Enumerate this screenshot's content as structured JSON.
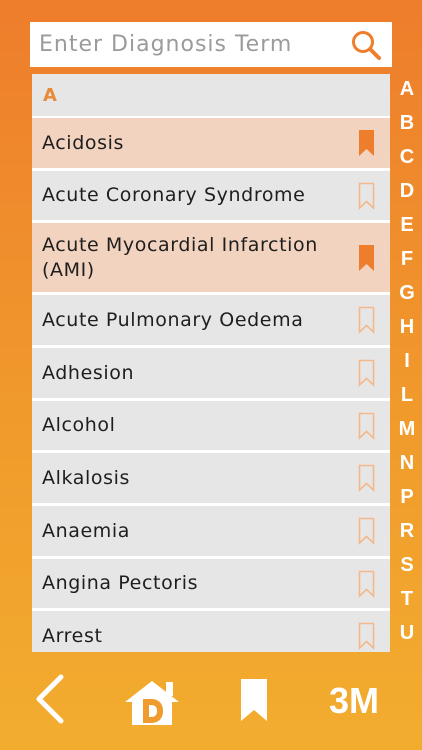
{
  "search": {
    "placeholder": "Enter Diagnosis Term"
  },
  "list": {
    "section_header": "A",
    "items": [
      {
        "label": "Acidosis",
        "bookmarked": true
      },
      {
        "label": "Acute Coronary Syndrome",
        "bookmarked": false
      },
      {
        "label": "Acute Myocardial Infarction (AMI)",
        "bookmarked": true
      },
      {
        "label": "Acute Pulmonary Oedema",
        "bookmarked": false
      },
      {
        "label": "Adhesion",
        "bookmarked": false
      },
      {
        "label": "Alcohol",
        "bookmarked": false
      },
      {
        "label": "Alkalosis",
        "bookmarked": false
      },
      {
        "label": "Anaemia",
        "bookmarked": false
      },
      {
        "label": "Angina Pectoris",
        "bookmarked": false
      },
      {
        "label": "Arrest",
        "bookmarked": false
      }
    ]
  },
  "alphabet": [
    "A",
    "B",
    "C",
    "D",
    "E",
    "F",
    "G",
    "H",
    "I",
    "L",
    "M",
    "N",
    "P",
    "R",
    "S",
    "T",
    "U"
  ],
  "toolbar": {
    "logo_text": "3M"
  },
  "colors": {
    "accent": "#ee7d2c",
    "selected_row": "#f2d3bf",
    "bookmark_filled": "#ee7d2c",
    "bookmark_outline": "#f3b88c"
  },
  "icons": [
    "search-icon",
    "bookmark-icon",
    "back-icon",
    "home-d-icon",
    "bookmarks-icon",
    "3m-logo"
  ]
}
